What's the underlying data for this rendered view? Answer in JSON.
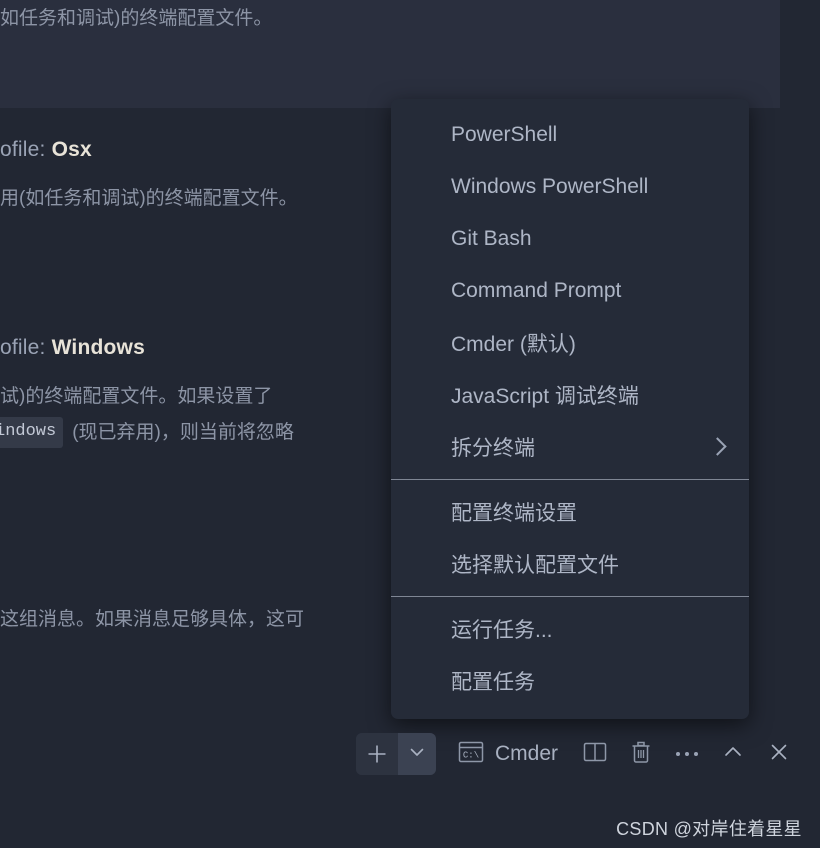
{
  "theme": {
    "app_background": "#222733",
    "panel_background": "#2a2f3e",
    "menu_background": "#252b38",
    "menu_text": "#aeb6c6",
    "separator": "#7f8694",
    "accent_value_text": "#e8e3d8",
    "icon_color": "#9aa3b5"
  },
  "settings_editor": {
    "top_clipped_description": "如任务和调试)的终端配置文件。",
    "blocks": [
      {
        "title_prefix": "ofile: ",
        "title_value": "Osx",
        "description": "用(如任务和调试)的终端配置文件。"
      },
      {
        "title_prefix": "ofile: ",
        "title_value": "Windows",
        "description_line1": "试)的终端配置文件。如果设置了",
        "description_code": "indows",
        "description_line2": "(现已弃用)，则当前将忽略"
      }
    ],
    "lower_clipped_description": "这组消息。如果消息足够具体，这可"
  },
  "context_menu": {
    "name": "terminal-profile-menu",
    "sections": [
      {
        "items": [
          {
            "label": "PowerShell",
            "name": "menu-item-powershell",
            "has_submenu": false
          },
          {
            "label": "Windows PowerShell",
            "name": "menu-item-windows-powershell",
            "has_submenu": false
          },
          {
            "label": "Git Bash",
            "name": "menu-item-git-bash",
            "has_submenu": false
          },
          {
            "label": "Command Prompt",
            "name": "menu-item-command-prompt",
            "has_submenu": false
          },
          {
            "label": "Cmder (默认)",
            "name": "menu-item-cmder-default",
            "has_submenu": false
          },
          {
            "label": "JavaScript 调试终端",
            "name": "menu-item-javascript-debug-terminal",
            "has_submenu": false
          },
          {
            "label": "拆分终端",
            "name": "menu-item-split-terminal",
            "has_submenu": true
          }
        ]
      },
      {
        "items": [
          {
            "label": "配置终端设置",
            "name": "menu-item-configure-terminal-settings",
            "has_submenu": false
          },
          {
            "label": "选择默认配置文件",
            "name": "menu-item-select-default-profile",
            "has_submenu": false
          }
        ]
      },
      {
        "items": [
          {
            "label": "运行任务...",
            "name": "menu-item-run-task",
            "has_submenu": false
          },
          {
            "label": "配置任务",
            "name": "menu-item-configure-task",
            "has_submenu": false
          }
        ]
      }
    ]
  },
  "toolbar": {
    "new_terminal_icon": "plus-icon",
    "new_terminal_dropdown_icon": "chevron-down-icon",
    "active_terminal": {
      "icon": "command-prompt-icon",
      "icon_text": "C:\\",
      "label": "Cmder"
    },
    "split_terminal_icon": "split-pane-icon",
    "kill_terminal_icon": "trash-icon",
    "more_actions_icon": "ellipsis-icon",
    "maximize_panel_icon": "chevron-up-icon",
    "close_panel_icon": "close-icon"
  },
  "watermark": {
    "text": "CSDN @对岸住着星星"
  }
}
